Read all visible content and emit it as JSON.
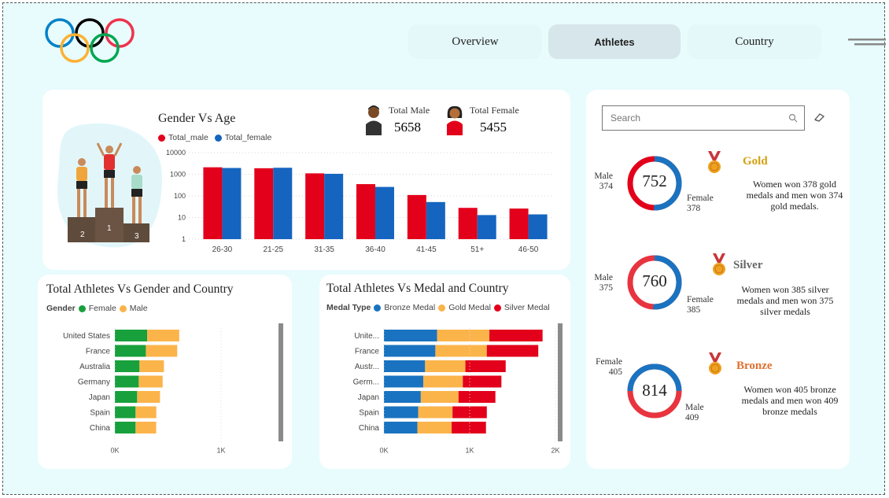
{
  "nav": {
    "tabs": [
      {
        "label": "Overview",
        "active": false
      },
      {
        "label": "Athletes",
        "active": true
      },
      {
        "label": "Country",
        "active": false
      }
    ]
  },
  "colors": {
    "male_red": "#e3001b",
    "female_blue": "#1565c0",
    "female_green": "#17a03c",
    "male_orange": "#fbb44a",
    "bronze_blue": "#1a73c0",
    "gold_orange": "#fbb44a",
    "silver_red": "#e3001b",
    "gold_title": "#d4a00e",
    "silver_title": "#666666",
    "bronze_title": "#e07030"
  },
  "gender_age": {
    "title": "Gender Vs Age",
    "totals": {
      "male_label": "Total Male",
      "male_value": "5658",
      "female_label": "Total Female",
      "female_value": "5455"
    }
  },
  "athletes_gender_country": {
    "title": "Total Athletes Vs Gender and Country"
  },
  "athletes_medal_country": {
    "title": "Total Athletes Vs Medal and Country"
  },
  "search": {
    "placeholder": "Search"
  },
  "medals": {
    "gold": {
      "title": "Gold",
      "total": "752",
      "left_label": "Male",
      "left_value": "374",
      "right_label": "Female",
      "right_value": "378",
      "description": "Women won 378 gold medals and men won 374 gold medals."
    },
    "silver": {
      "title": "Silver",
      "total": "760",
      "left_label": "Male",
      "left_value": "375",
      "right_label": "Female",
      "right_value": "385",
      "description": "Women won 385 silver medals and men won 375 silver medals"
    },
    "bronze": {
      "title": "Bronze",
      "total": "814",
      "left_label": "Female",
      "left_value": "405",
      "right_label": "Male",
      "right_value": "409",
      "description": "Women  won 405 bronze medals and men won 409 bronze medals"
    }
  },
  "chart_data": [
    {
      "type": "bar",
      "title": "Gender Vs Age",
      "scale": "log",
      "ylim": [
        1,
        10000
      ],
      "yticks": [
        "10000",
        "1000",
        "100",
        "10",
        "1"
      ],
      "categories": [
        "26-30",
        "21-25",
        "31-35",
        "36-40",
        "41-45",
        "51+",
        "46-50"
      ],
      "series": [
        {
          "name": "Total_male",
          "values": [
            2100,
            1900,
            1100,
            350,
            110,
            28,
            26
          ]
        },
        {
          "name": "Total_female",
          "values": [
            1950,
            2000,
            1050,
            260,
            52,
            13,
            14
          ]
        }
      ],
      "legend": "top-left",
      "grid": true
    },
    {
      "type": "bar",
      "orientation": "horizontal",
      "stacked": true,
      "title": "Total Athletes Vs Gender and Country",
      "legend_title": "Gender",
      "categories": [
        "United States",
        "France",
        "Australia",
        "Germany",
        "Japan",
        "Spain",
        "China"
      ],
      "series": [
        {
          "name": "Female",
          "values": [
            305,
            292,
            232,
            225,
            210,
            195,
            195
          ]
        },
        {
          "name": "Male",
          "values": [
            301,
            295,
            230,
            225,
            215,
            195,
            194
          ]
        }
      ],
      "xlim": [
        0,
        1200
      ],
      "xticks": [
        "0K",
        "1K"
      ]
    },
    {
      "type": "bar",
      "orientation": "horizontal",
      "stacked": true,
      "title": "Total Athletes Vs Medal and Country",
      "legend_title": "Medal Type",
      "categories": [
        "Unite...",
        "France",
        "Austr...",
        "Germ...",
        "Japan",
        "Spain",
        "China"
      ],
      "series": [
        {
          "name": "Bronze Medal",
          "values": [
            620,
            600,
            480,
            460,
            430,
            400,
            390
          ]
        },
        {
          "name": "Gold Medal",
          "values": [
            610,
            600,
            470,
            460,
            440,
            400,
            400
          ]
        },
        {
          "name": "Silver Medal",
          "values": [
            620,
            600,
            470,
            450,
            430,
            400,
            400
          ]
        }
      ],
      "xlim": [
        0,
        2000
      ],
      "xticks": [
        "0K",
        "1K",
        "2K"
      ]
    }
  ]
}
